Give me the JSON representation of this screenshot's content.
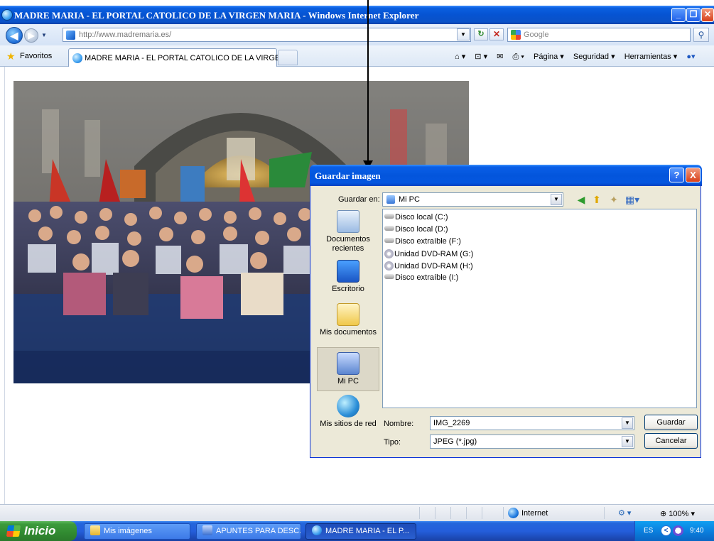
{
  "browser": {
    "window_title": "MADRE MARIA - EL PORTAL CATOLICO DE LA VIRGEN MARIA - Windows Internet Explorer",
    "address_url": "http://www.madremaria.es/",
    "search_placeholder": "Google",
    "favorites_label": "Favoritos",
    "tab_title": "MADRE MARIA - EL PORTAL CATOLICO DE LA VIRGE...",
    "tools": {
      "page": "Página",
      "security": "Seguridad",
      "tools": "Herramientas"
    },
    "status_zone": "Internet",
    "zoom": "100%"
  },
  "dialog": {
    "title": "Guardar imagen",
    "save_in_label": "Guardar en:",
    "save_in_value": "Mi PC",
    "places": [
      {
        "label": "Documentos recientes"
      },
      {
        "label": "Escritorio"
      },
      {
        "label": "Mis documentos"
      },
      {
        "label": "Mi PC"
      },
      {
        "label": "Mis sitios de red"
      }
    ],
    "files": [
      "Disco local (C:)",
      "Disco local (D:)",
      "Disco extraíble (F:)",
      "Unidad DVD-RAM (G:)",
      "Unidad DVD-RAM (H:)",
      "Disco extraíble (I:)"
    ],
    "filename_label": "Nombre:",
    "filename_value": "IMG_2269",
    "type_label": "Tipo:",
    "type_value": "JPEG (*.jpg)",
    "save_button": "Guardar",
    "cancel_button": "Cancelar",
    "help_button": "?",
    "close_button": "X"
  },
  "taskbar": {
    "start_label": "Inicio",
    "tasks": [
      {
        "label": "Mis imágenes"
      },
      {
        "label": "APUNTES PARA DESC..."
      },
      {
        "label": "MADRE MARIA - EL P..."
      }
    ],
    "language": "ES",
    "time": "9:40"
  }
}
